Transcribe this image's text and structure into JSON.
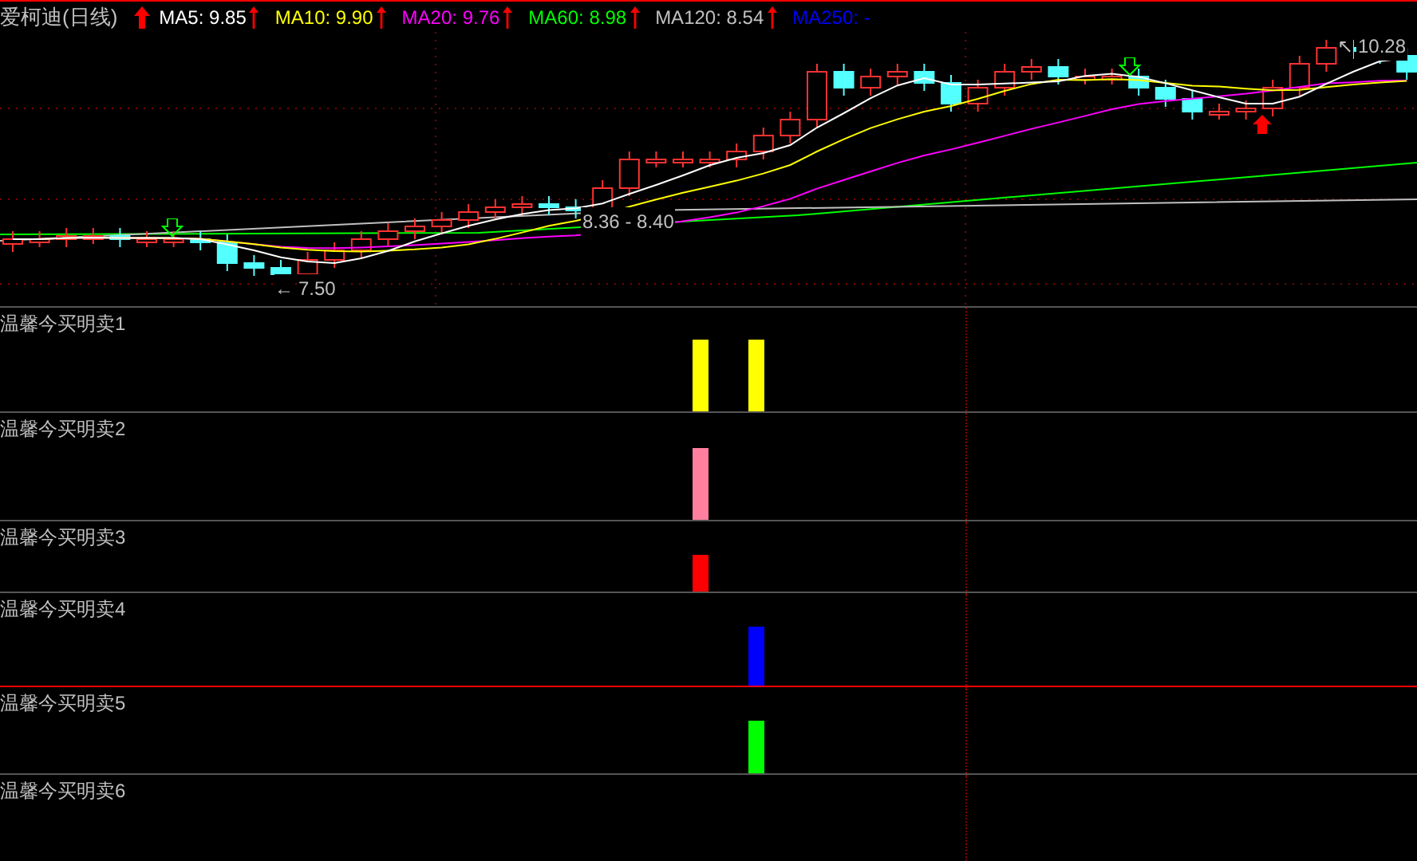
{
  "header": {
    "title": "爱柯迪(日线)",
    "rising": true,
    "averages": [
      {
        "label": "MA5:",
        "value": "9.85",
        "color": "#ffffff",
        "rising": true
      },
      {
        "label": "MA10:",
        "value": "9.90",
        "color": "#ffff00",
        "rising": true
      },
      {
        "label": "MA20:",
        "value": "9.76",
        "color": "#ff00ff",
        "rising": true
      },
      {
        "label": "MA60:",
        "value": "8.98",
        "color": "#00ff00",
        "rising": true
      },
      {
        "label": "MA120:",
        "value": "8.54",
        "color": "#c0c0c0",
        "rising": true
      },
      {
        "label": "MA250:",
        "value": "-",
        "color": "#0000ff",
        "rising": false
      }
    ]
  },
  "chart": {
    "annotations": [
      {
        "text": "8.36 - 8.40"
      },
      {
        "pointer": "←",
        "text": "7.50"
      },
      {
        "pointer": "↖",
        "text": "10.28"
      }
    ]
  },
  "panes": [
    {
      "title": "温馨今买明卖1",
      "selected": false,
      "color": "#ffff00",
      "marks": [
        true,
        true
      ]
    },
    {
      "title": "温馨今买明卖2",
      "selected": false,
      "color": "#ff7f9f",
      "marks": [
        true,
        false
      ]
    },
    {
      "title": "温馨今买明卖3",
      "selected": false,
      "color": "#ff0000",
      "marks": [
        true,
        false
      ]
    },
    {
      "title": "温馨今买明卖4",
      "selected": false,
      "color": "#0000ff",
      "marks": [
        false,
        true
      ]
    },
    {
      "title": "温馨今买明卖5",
      "selected": true,
      "color": "#00ff00",
      "marks": [
        false,
        true
      ]
    },
    {
      "title": "温馨今买明卖6",
      "selected": false,
      "marks": [
        false,
        false
      ]
    }
  ]
}
